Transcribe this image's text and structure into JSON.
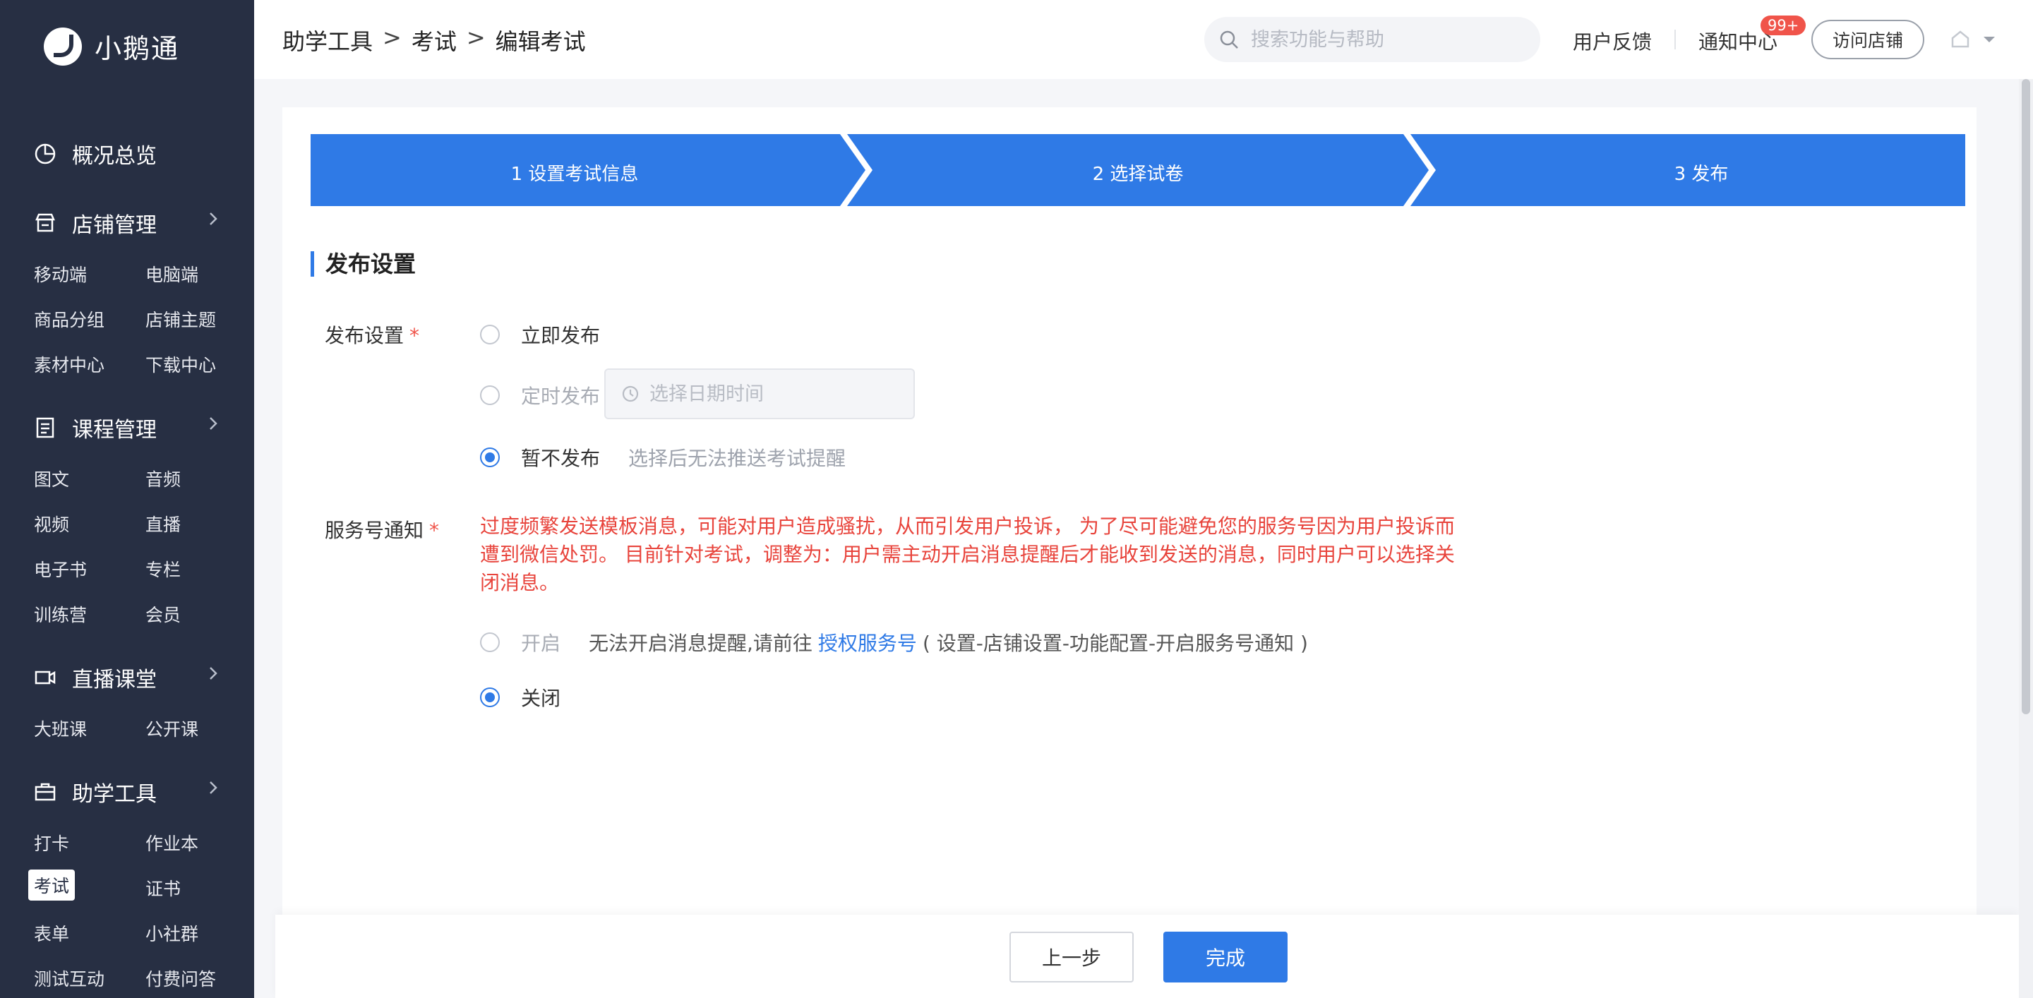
{
  "app": {
    "name": "小鹅通"
  },
  "sidebar": {
    "groups": [
      {
        "title": "概况总览",
        "icon": "pie-chart-icon",
        "items": []
      },
      {
        "title": "店铺管理",
        "icon": "store-icon",
        "items": [
          "移动端",
          "电脑端",
          "商品分组",
          "店铺主题",
          "素材中心",
          "下载中心"
        ]
      },
      {
        "title": "课程管理",
        "icon": "document-icon",
        "items": [
          "图文",
          "音频",
          "视频",
          "直播",
          "电子书",
          "专栏",
          "训练营",
          "会员"
        ]
      },
      {
        "title": "直播课堂",
        "icon": "video-camera-icon",
        "items": [
          "大班课",
          "公开课"
        ]
      },
      {
        "title": "助学工具",
        "icon": "toolbox-icon",
        "items": [
          "打卡",
          "作业本",
          "考试",
          "证书",
          "表单",
          "小社群",
          "测试互动",
          "付费问答"
        ]
      }
    ],
    "active_item": "考试"
  },
  "header": {
    "breadcrumb": [
      "助学工具",
      "考试",
      "编辑考试"
    ],
    "breadcrumb_sep": ">",
    "search_placeholder": "搜索功能与帮助",
    "feedback": "用户反馈",
    "notifications": "通知中心",
    "notification_badge": "99+",
    "visit_store": "访问店铺"
  },
  "steps": [
    "1 设置考试信息",
    "2 选择试卷",
    "3 发布"
  ],
  "colors": {
    "primary": "#2f7ae6",
    "danger": "#e8443c",
    "sidebar_bg": "#272f43"
  },
  "section": {
    "title": "发布设置"
  },
  "publish": {
    "label": "发布设置",
    "required_mark": "*",
    "options": [
      {
        "label": "立即发布",
        "checked": false
      },
      {
        "label": "定时发布",
        "checked": false,
        "datetime_placeholder": "选择日期时间"
      },
      {
        "label": "暂不发布",
        "checked": true,
        "hint": "选择后无法推送考试提醒"
      }
    ]
  },
  "service_notice": {
    "label": "服务号通知",
    "required_mark": "*",
    "warning": "过度频繁发送模板消息，可能对用户造成骚扰，从而引发用户投诉， 为了尽可能避免您的服务号因为用户投诉而遭到微信处罚。 目前针对考试，调整为：用户需主动开启消息提醒后才能收到发送的消息，同时用户可以选择关闭消息。",
    "on_label": "开启",
    "on_desc": "无法开启消息提醒,请前往",
    "on_link": "授权服务号",
    "on_path": "( 设置-店铺设置-功能配置-开启服务号通知 )",
    "off_label": "关闭",
    "selected": "off"
  },
  "footer": {
    "prev": "上一步",
    "done": "完成"
  }
}
